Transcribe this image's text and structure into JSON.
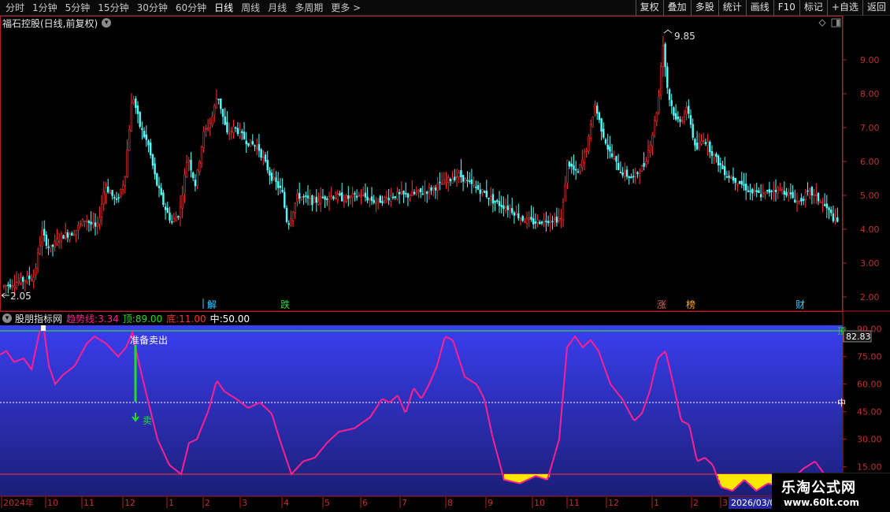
{
  "toolbar": {
    "periods": [
      "分时",
      "1分钟",
      "5分钟",
      "15分钟",
      "30分钟",
      "60分钟",
      "日线",
      "周线",
      "月线",
      "多周期",
      "更多 >"
    ],
    "active_period": "日线",
    "buttons": [
      "复权",
      "叠加",
      "多股",
      "统计",
      "画线",
      "F10",
      "标记",
      "+自选",
      "返回"
    ]
  },
  "main_chart": {
    "title": "福石控股(日线,前复权)",
    "y_ticks": [
      "9.00",
      "8.00",
      "7.00",
      "6.00",
      "5.00",
      "4.00",
      "3.00",
      "2.00"
    ],
    "high_label": "9.85",
    "low_label": "2.05",
    "markers": [
      {
        "text": "解",
        "color": "#2fd0ff"
      },
      {
        "text": "跌",
        "color": "#22dd44"
      },
      {
        "text": "涨",
        "color": "#ff5555"
      },
      {
        "text": "榜",
        "color": "#ffaa00"
      },
      {
        "text": "财",
        "color": "#2fd0ff"
      }
    ],
    "colors": {
      "up": "#ff3232",
      "down": "#54ffff",
      "axis": "#b02020"
    }
  },
  "indicator": {
    "name": "股朋指标网",
    "values": [
      {
        "label": "趋势线:",
        "value": "3.34",
        "color": "#ff2090"
      },
      {
        "label": "顶:",
        "value": "89.00",
        "color": "#22dd22"
      },
      {
        "label": "底:",
        "value": "11.00",
        "color": "#ff3030"
      },
      {
        "label": "中:",
        "value": "50.00",
        "color": "#ffffff"
      }
    ],
    "y_ticks": [
      "90.00",
      "75.00",
      "60.00",
      "45.00",
      "30.00",
      "15.00"
    ],
    "current_value": "82.83",
    "top_flag": "顶",
    "mid_flag": "中",
    "signal_text": "准备卖出",
    "sell_text": "卖"
  },
  "time_axis": [
    "2024年",
    "10",
    "11",
    "12",
    "1",
    "2",
    "3",
    "4",
    "5",
    "6",
    "7",
    "8",
    "9",
    "10",
    "11",
    "12",
    "1",
    "2",
    "3"
  ],
  "current_date": "2026/03/0",
  "watermark": {
    "line1": "乐淘公式网",
    "line2": "www.60lt.com"
  }
}
